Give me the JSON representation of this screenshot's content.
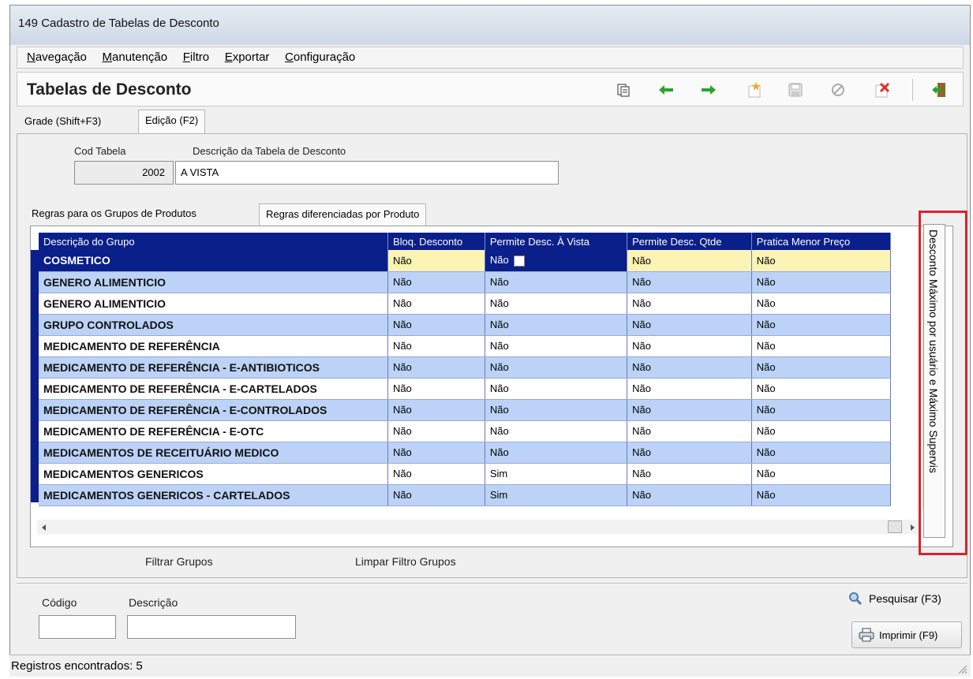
{
  "window": {
    "title": "149 Cadastro de Tabelas de Desconto"
  },
  "menu": [
    "Navegação",
    "Manutenção",
    "Filtro",
    "Exportar",
    "Configuração"
  ],
  "toolbar": {
    "title": "Tabelas de Desconto",
    "icons": [
      "copy-icon",
      "arrow-left-icon",
      "arrow-right-icon",
      "new-record-icon",
      "save-icon",
      "cancel-icon",
      "delete-icon",
      "exit-icon"
    ]
  },
  "main_tabs": [
    "Grade (Shift+F3)",
    "Edição (F2)"
  ],
  "edit": {
    "cod_label": "Cod Tabela",
    "cod_value": "2002",
    "desc_label": "Descrição da Tabela de Desconto",
    "desc_value": "A VISTA"
  },
  "sub_tabs": [
    "Regras para os Grupos de Produtos",
    "Regras diferenciadas por Produto"
  ],
  "grid": {
    "columns": [
      "Descrição do Grupo",
      "Bloq. Desconto",
      "Permite Desc. À Vista",
      "Permite Desc. Qtde",
      "Pratica Menor Preço"
    ],
    "rows": [
      [
        "COSMETICO",
        "Não",
        "Não",
        "Não",
        "Não"
      ],
      [
        "GENERO ALIMENTICIO",
        "Não",
        "Não",
        "Não",
        "Não"
      ],
      [
        "GENERO ALIMENTICIO",
        "Não",
        "Não",
        "Não",
        "Não"
      ],
      [
        "GRUPO CONTROLADOS",
        "Não",
        "Não",
        "Não",
        "Não"
      ],
      [
        "MEDICAMENTO DE REFERÊNCIA",
        "Não",
        "Não",
        "Não",
        "Não"
      ],
      [
        "MEDICAMENTO DE REFERÊNCIA - E-ANTIBIOTICOS",
        "Não",
        "Não",
        "Não",
        "Não"
      ],
      [
        "MEDICAMENTO DE REFERÊNCIA - E-CARTELADOS",
        "Não",
        "Não",
        "Não",
        "Não"
      ],
      [
        "MEDICAMENTO DE REFERÊNCIA - E-CONTROLADOS",
        "Não",
        "Não",
        "Não",
        "Não"
      ],
      [
        "MEDICAMENTO DE REFERÊNCIA - E-OTC",
        "Não",
        "Não",
        "Não",
        "Não"
      ],
      [
        "MEDICAMENTOS DE RECEITUÁRIO MEDICO",
        "Não",
        "Não",
        "Não",
        "Não"
      ],
      [
        "MEDICAMENTOS GENERICOS",
        "Não",
        "Sim",
        "Não",
        "Não"
      ],
      [
        "MEDICAMENTOS GENERICOS - CARTELADOS",
        "Não",
        "Sim",
        "Não",
        "Não"
      ]
    ]
  },
  "side_tab": "Desconto Máximo por usuário e Máximo Supervis",
  "filter": {
    "filter_label": "Filtrar Grupos",
    "clear_label": "Limpar Filtro Grupos"
  },
  "search": {
    "codigo_label": "Código",
    "descricao_label": "Descrição",
    "codigo_value": "",
    "descricao_value": "",
    "search_button": "Pesquisar (F3)",
    "print_button": "Imprimir (F9)"
  },
  "status": "Registros encontrados: 5"
}
